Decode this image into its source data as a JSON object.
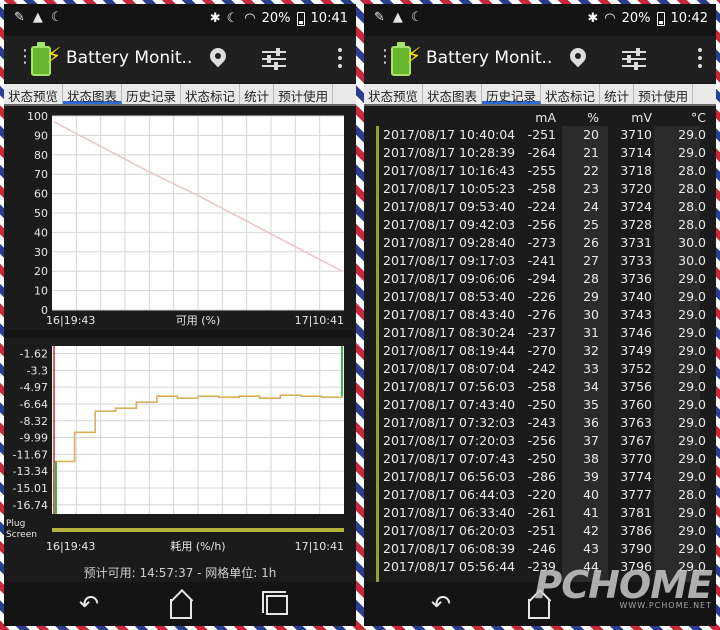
{
  "status_bar": {
    "battery_percent": "20%",
    "time_left": "10:41",
    "time_right": "10:42"
  },
  "app": {
    "title": "Battery Monit..",
    "accent": "#2b6cd8"
  },
  "tabs": {
    "left": [
      "状态预览",
      "状态图表",
      "历史记录",
      "状态标记",
      "统计",
      "预计使用"
    ],
    "right": [
      "状态预览",
      "状态图表",
      "历史记录",
      "状态标记",
      "统计",
      "预计使用"
    ],
    "left_active": 1,
    "right_active": 2
  },
  "chart_data": [
    {
      "type": "line",
      "title": "",
      "xlabel": "可用 (%)",
      "ylabel": "",
      "x_tick_labels": [
        "16|19:43",
        "17|10:41"
      ],
      "y_ticks": [
        100,
        90,
        80,
        70,
        60,
        50,
        40,
        30,
        20,
        10,
        0
      ],
      "ylim": [
        0,
        100
      ],
      "series": [
        {
          "values": [
            97,
            84,
            71,
            59,
            46,
            33,
            20
          ]
        }
      ],
      "line_color": "#e8c8c8",
      "grid": true
    },
    {
      "type": "line",
      "title": "",
      "xlabel": "耗用 (%/h)",
      "ylabel": "",
      "x_tick_labels": [
        "16|19:43",
        "17|10:41"
      ],
      "y_ticks": [
        -1.62,
        -3.3,
        -4.97,
        -6.64,
        -8.32,
        -9.99,
        -11.67,
        -13.34,
        -15.01,
        -16.74
      ],
      "ylim": [
        -16.74,
        0
      ],
      "series": [
        {
          "values": [
            -11.5,
            -8.6,
            -6.5,
            -6.2,
            -5.6,
            -5.0,
            -5.2,
            -5.0,
            -5.1,
            -5.0,
            -5.2,
            -4.9,
            -5.0,
            -5.1,
            -5.0
          ]
        }
      ],
      "line_color": "#e8c060",
      "extra_rows": [
        "Plug",
        "Screen"
      ],
      "grid": true
    }
  ],
  "footer": {
    "text": "预计可用:   14:57:37 - 网格单位:   1h"
  },
  "history": {
    "headers": [
      "mA",
      "%",
      "mV",
      "°C"
    ],
    "rows": [
      [
        "2017/08/17",
        "10:40:04",
        "-251",
        "20",
        "3710",
        "29.0"
      ],
      [
        "2017/08/17",
        "10:28:39",
        "-264",
        "21",
        "3714",
        "29.0"
      ],
      [
        "2017/08/17",
        "10:16:43",
        "-255",
        "22",
        "3718",
        "28.0"
      ],
      [
        "2017/08/17",
        "10:05:23",
        "-258",
        "23",
        "3720",
        "28.0"
      ],
      [
        "2017/08/17",
        "09:53:40",
        "-224",
        "24",
        "3724",
        "28.0"
      ],
      [
        "2017/08/17",
        "09:42:03",
        "-256",
        "25",
        "3728",
        "28.0"
      ],
      [
        "2017/08/17",
        "09:28:40",
        "-273",
        "26",
        "3731",
        "30.0"
      ],
      [
        "2017/08/17",
        "09:17:03",
        "-241",
        "27",
        "3733",
        "30.0"
      ],
      [
        "2017/08/17",
        "09:06:06",
        "-294",
        "28",
        "3736",
        "29.0"
      ],
      [
        "2017/08/17",
        "08:53:40",
        "-226",
        "29",
        "3740",
        "29.0"
      ],
      [
        "2017/08/17",
        "08:43:40",
        "-276",
        "30",
        "3743",
        "29.0"
      ],
      [
        "2017/08/17",
        "08:30:24",
        "-237",
        "31",
        "3746",
        "29.0"
      ],
      [
        "2017/08/17",
        "08:19:44",
        "-270",
        "32",
        "3749",
        "29.0"
      ],
      [
        "2017/08/17",
        "08:07:04",
        "-242",
        "33",
        "3752",
        "29.0"
      ],
      [
        "2017/08/17",
        "07:56:03",
        "-258",
        "34",
        "3756",
        "29.0"
      ],
      [
        "2017/08/17",
        "07:43:40",
        "-250",
        "35",
        "3760",
        "29.0"
      ],
      [
        "2017/08/17",
        "07:32:03",
        "-243",
        "36",
        "3763",
        "29.0"
      ],
      [
        "2017/08/17",
        "07:20:03",
        "-256",
        "37",
        "3767",
        "29.0"
      ],
      [
        "2017/08/17",
        "07:07:43",
        "-250",
        "38",
        "3770",
        "29.0"
      ],
      [
        "2017/08/17",
        "06:56:03",
        "-286",
        "39",
        "3774",
        "29.0"
      ],
      [
        "2017/08/17",
        "06:44:03",
        "-220",
        "40",
        "3777",
        "28.0"
      ],
      [
        "2017/08/17",
        "06:33:40",
        "-261",
        "41",
        "3781",
        "29.0"
      ],
      [
        "2017/08/17",
        "06:20:03",
        "-251",
        "42",
        "3786",
        "29.0"
      ],
      [
        "2017/08/17",
        "06:08:39",
        "-246",
        "43",
        "3790",
        "29.0"
      ],
      [
        "2017/08/17",
        "05:56:44",
        "-239",
        "44",
        "3796",
        "29.0"
      ]
    ]
  },
  "watermark": {
    "main": "PCHOME",
    "sub": "WWW.PCHOME.NET"
  }
}
